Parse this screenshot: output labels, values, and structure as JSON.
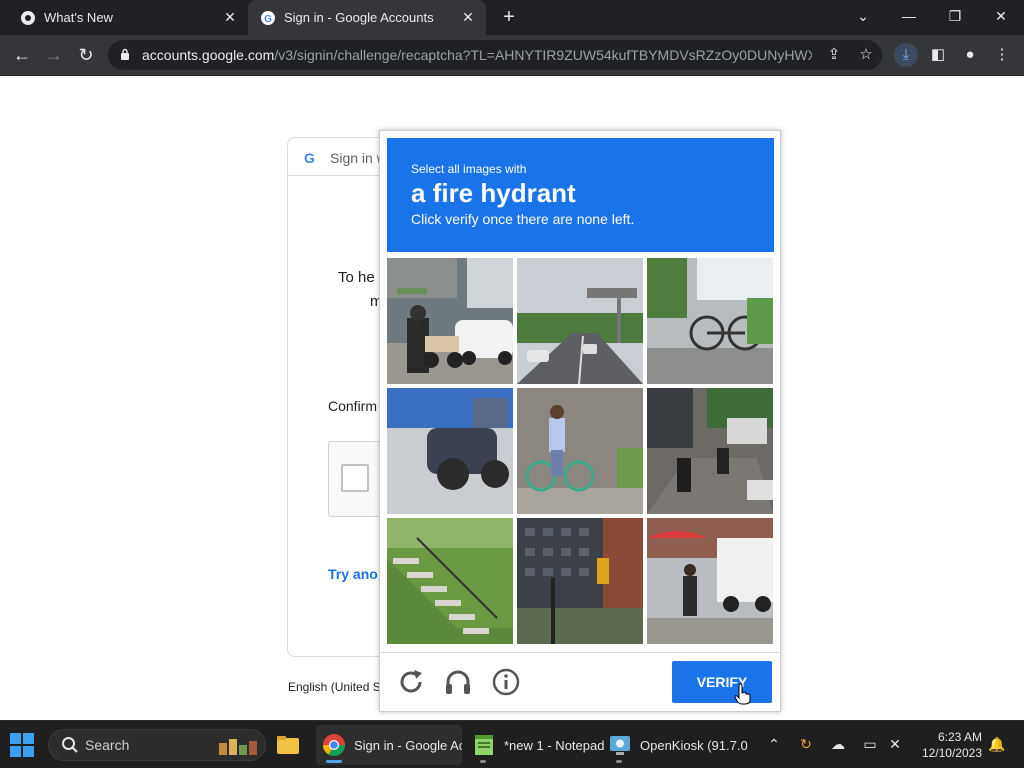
{
  "browser": {
    "tabs": [
      {
        "title": "What's New",
        "icon": "chrome-icon"
      },
      {
        "title": "Sign in - Google Accounts",
        "icon": "google-icon"
      }
    ],
    "url_host": "accounts.google.com",
    "url_path": "/v3/signin/challenge/recaptcha?TL=AHNYTIR9ZUW54kufTBYMDVsRZzOy0DUNyHWX..."
  },
  "signin": {
    "header_label": "Sign in w",
    "line1": "To he",
    "line2": "m",
    "confirm_label": "Confirm",
    "try_another": "Try ano",
    "footer_language": "English (United S"
  },
  "recaptcha": {
    "instruction_small": "Select all images with",
    "instruction_target": "a fire hydrant",
    "instruction_sub": "Click verify once there are none left.",
    "verify_label": "VERIFY",
    "accent_color": "#1a73e8",
    "tiles": [
      {
        "scene": "street with motorcycle and white car"
      },
      {
        "scene": "road with overhead sign"
      },
      {
        "scene": "bicycles near building"
      },
      {
        "scene": "motorcycle on blue floor"
      },
      {
        "scene": "person riding bicycle by wall"
      },
      {
        "scene": "street with motorcycles and truck"
      },
      {
        "scene": "stairs on grassy hill"
      },
      {
        "scene": "buildings with traffic light"
      },
      {
        "scene": "street with red umbrella and truck"
      }
    ]
  },
  "taskbar": {
    "search_label": "Search",
    "apps": [
      {
        "label": "Sign in - Google Ac",
        "icon": "chrome-icon"
      },
      {
        "label": "*new 1 - Notepad",
        "icon": "notepad-icon"
      },
      {
        "label": "OpenKiosk (91.7.0.0)",
        "icon": "openkiosk-icon"
      }
    ],
    "time": "6:23 AM",
    "date": "12/10/2023"
  }
}
